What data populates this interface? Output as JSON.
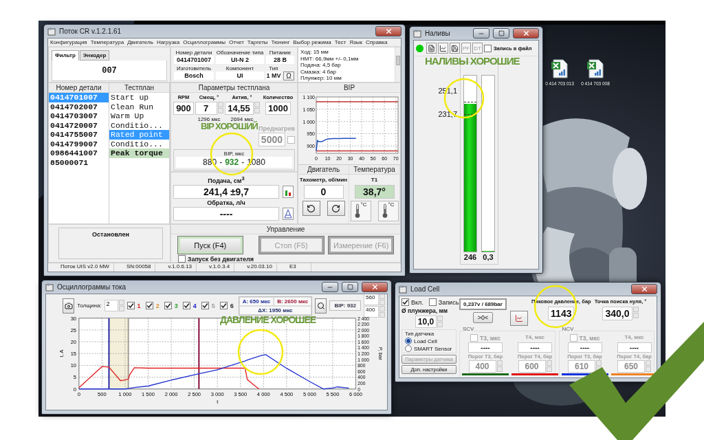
{
  "desktop": {
    "icons": [
      {
        "label": "0 414 703 013"
      },
      {
        "label": "0 414 703 008"
      }
    ]
  },
  "main_window": {
    "title": "Поток CR v.1.2.1.61",
    "menu": [
      "Конфигурация",
      "Температура",
      "Двигатель",
      "Нагрузка",
      "Осциллограммы",
      "Отчет",
      "Таргеты",
      "Тюнинг",
      "Выбор режима",
      "Тест",
      "Язык",
      "Справка"
    ],
    "filter": {
      "tabs": [
        {
          "label": "Фильтр",
          "selected": true
        },
        {
          "label": "Энкодер",
          "selected": false
        }
      ],
      "value": "007"
    },
    "part_info": {
      "fields": [
        {
          "label": "Номер детали",
          "value": "0414701007"
        },
        {
          "label": "Обозначение типа",
          "value": "UI-N 2"
        },
        {
          "label": "Питание",
          "value": "28 В"
        },
        {
          "label": "Изготовитель",
          "value": "Bosch"
        },
        {
          "label": "Компонент",
          "value": "UI"
        },
        {
          "label": "Тип",
          "value": "1 MV"
        }
      ],
      "button": "Ω"
    },
    "notes": [
      "Ход: 15 мм",
      "НМТ: 66,9мм +/- 0,1мм",
      "Подача: 4,5 бар",
      "Смазка: 4 бар",
      "Плунжер: 10 мм"
    ],
    "parts": {
      "header": "Номер детали",
      "items": [
        {
          "label": "0414701007",
          "selected": true
        },
        {
          "label": "0414702007",
          "selected": false
        },
        {
          "label": "0414703007",
          "selected": false
        },
        {
          "label": "0414720007",
          "selected": false
        },
        {
          "label": "0414755007",
          "selected": false
        },
        {
          "label": "0414799007",
          "selected": false
        },
        {
          "label": "0986441007",
          "selected": false
        },
        {
          "label": "85000071",
          "selected": false
        }
      ]
    },
    "testplan": {
      "header": "Тестплан",
      "items": [
        {
          "label": "Start up",
          "selected": false,
          "completed": false
        },
        {
          "label": "Clean Run",
          "selected": false,
          "completed": false
        },
        {
          "label": "Warm Up",
          "selected": false,
          "completed": false
        },
        {
          "label": "Conditio...",
          "selected": false,
          "completed": false
        },
        {
          "label": "Rated point",
          "selected": true,
          "completed": false
        },
        {
          "label": "Conditio...",
          "selected": false,
          "completed": false
        },
        {
          "label": "Peak torque",
          "selected": false,
          "completed": true
        }
      ]
    },
    "params": {
      "title": "Параметры тестплана",
      "fields": [
        {
          "label": "RPM",
          "value": "900",
          "kind": "plain"
        },
        {
          "label": "Смещ, °",
          "value": "7",
          "kind": "spin",
          "note": "1296 мкс"
        },
        {
          "label": "Актив, °",
          "value": "14,55",
          "kind": "spin",
          "note": "2694 мкс"
        },
        {
          "label": "Количество",
          "value": "1000",
          "kind": "plain"
        }
      ],
      "preheat": {
        "label": "Преднагрев",
        "value": "5000",
        "checked": false,
        "disabled": true
      },
      "bip": {
        "label": "BIP, мкс",
        "min": "880",
        "sep_1": "-",
        "value": "932",
        "sep_2": "-",
        "max": "1080"
      }
    },
    "feed": {
      "label": "Подача, см$^{3}$",
      "value": "241,4 ±9,7"
    },
    "return": {
      "label": "Обратка, л/ч",
      "value": "----"
    },
    "bip_chart": {
      "chart_data": {
        "type": "line",
        "title": "BIP",
        "x": [
          0,
          1,
          2,
          3,
          5,
          8,
          10,
          15,
          20,
          25,
          30,
          35,
          72
        ],
        "series": [
          {
            "color": "#c03030",
            "values": [
              1080,
              1080,
              1080,
              1080,
              1080,
              1080,
              1080,
              1080,
              1080,
              1080,
              1080,
              1080,
              1080
            ]
          },
          {
            "color": "#c03030",
            "values": [
              880,
              880,
              880,
              880,
              880,
              880,
              880,
              880,
              880,
              880,
              880,
              880,
              880
            ]
          },
          {
            "color": "#2050c0",
            "values": [
              880,
              922,
              918,
              918,
              918,
              925,
              928,
              930,
              930,
              931,
              931,
              931,
              null
            ]
          }
        ],
        "grid": true,
        "xlim": [
          0,
          72
        ],
        "ylim": [
          870,
          1100
        ],
        "xticks": [
          0,
          10,
          20,
          30,
          40,
          50,
          60,
          70
        ],
        "yticks": [
          {
            "value": 900,
            "label": "900"
          },
          {
            "value": 950,
            "label": "950"
          },
          {
            "value": 1000,
            "label": "1 000"
          },
          {
            "value": 1050,
            "label": "1 050"
          },
          {
            "value": 1100,
            "label": "1 100"
          }
        ]
      }
    },
    "engine": {
      "title": "Двигатель",
      "label": "Тахометр, об/мин",
      "value": "0"
    },
    "temperature": {
      "title": "Температура",
      "label": "T1",
      "value": "38,7°",
      "buttons": [
        "°C",
        "°C"
      ]
    },
    "status": "Остановлен",
    "control": {
      "title": "Управление",
      "buttons": [
        {
          "label": "Пуск (F4)",
          "disabled": false
        },
        {
          "label": "Стоп (F5)",
          "disabled": true
        },
        {
          "label": "Измерение (F6)",
          "disabled": true
        }
      ],
      "no_engine": {
        "label": "Запуск без двигателя",
        "checked": false
      }
    },
    "status_bar": [
      "Поток UIS v2.0 MW",
      "SN:00058",
      "v.1.0.6.13",
      "v.1.0.3.4",
      "v.20.03.10",
      "E3"
    ]
  },
  "levels_window": {
    "title": "Наливы",
    "connected": true,
    "text_buttons": [
      {
        "label": "PF",
        "disabled": true
      },
      {
        "label": "DT",
        "disabled": true
      }
    ],
    "record": {
      "label": "Запись в файл",
      "checked": false
    },
    "limits": [
      "251,1",
      "231,7"
    ],
    "bars": [
      {
        "level": 0.84,
        "value": "246"
      },
      {
        "level": 0,
        "value": "0,3"
      }
    ]
  },
  "scope_window": {
    "title": "Осциллограммы тока",
    "thickness_label": "Толщина:",
    "thickness": "2",
    "channels": [
      {
        "label": "1",
        "checked": true,
        "color": "#e02020"
      },
      {
        "label": "2",
        "checked": true,
        "color": "#e09030"
      },
      {
        "label": "3",
        "checked": true,
        "color": "#30a030"
      },
      {
        "label": "4",
        "checked": true,
        "color": "#2020d0"
      },
      {
        "label": "5",
        "checked": true,
        "color": "#a0a0a0"
      },
      {
        "label": "6",
        "checked": true,
        "color": "#303030"
      }
    ],
    "cursor_a": "A: 650 мкс",
    "cursor_b": "B: 2600 мкс",
    "delta": "ΔX: 1950 мкс",
    "bip": "BIP: 932",
    "range": [
      "560",
      "400"
    ],
    "chart_data": {
      "type": "line",
      "xlabel": "t",
      "ylabel": "I, A",
      "y2label": "P, bar",
      "x": [
        0,
        250,
        500,
        650,
        660,
        900,
        1000,
        1070,
        1100,
        1200,
        1500,
        2000,
        2500,
        3000,
        3500,
        3600,
        3650,
        3800,
        3900,
        4000,
        4050,
        4500,
        5000,
        5300,
        5500,
        5600,
        5800,
        5850
      ],
      "series": [
        {
          "color": "#e02020",
          "values": [
            0.5,
            5,
            9.5,
            9.3,
            9,
            3.5,
            3.8,
            4.2,
            6,
            9,
            8.8,
            8.8,
            8.8,
            8.8,
            8.8,
            8.8,
            4,
            1.5,
            0,
            null,
            null,
            null,
            null,
            null,
            null,
            null,
            null,
            null
          ]
        },
        {
          "color": "#2030d0",
          "axis": "y2",
          "values": [
            0,
            0,
            0,
            0,
            0,
            0,
            0,
            10,
            20,
            50,
            100,
            300,
            480,
            650,
            900,
            950,
            980,
            1060,
            1110,
            1150,
            1160,
            700,
            250,
            0,
            30,
            70,
            40,
            30
          ]
        }
      ],
      "grid": true,
      "xlim": [
        0,
        6000
      ],
      "ylim": [
        0,
        30
      ],
      "y2lim": [
        0,
        2400
      ],
      "xticks": [
        {
          "value": 0,
          "label": "0"
        },
        {
          "value": 500,
          "label": "500"
        },
        {
          "value": 1000,
          "label": "1 000"
        },
        {
          "value": 1500,
          "label": "1 500"
        },
        {
          "value": 2000,
          "label": "2 000"
        },
        {
          "value": 2500,
          "label": "2 500"
        },
        {
          "value": 3000,
          "label": "3 000"
        },
        {
          "value": 3500,
          "label": "3 500"
        },
        {
          "value": 4000,
          "label": "4 000"
        },
        {
          "value": 4500,
          "label": "4 500"
        },
        {
          "value": 5000,
          "label": "5 000"
        },
        {
          "value": 5500,
          "label": "5 500"
        },
        {
          "value": 6000,
          "label": "6 000"
        }
      ],
      "yticks": [
        0,
        5,
        10,
        15,
        20,
        25,
        30
      ],
      "y2ticks": [
        {
          "value": 0,
          "label": "0"
        },
        {
          "value": 200,
          "label": "200"
        },
        {
          "value": 400,
          "label": "400"
        },
        {
          "value": 600,
          "label": "600"
        },
        {
          "value": 800,
          "label": "800"
        },
        {
          "value": 1000,
          "label": "1 000"
        },
        {
          "value": 1200,
          "label": "1 200"
        },
        {
          "value": 1400,
          "label": "1 400"
        },
        {
          "value": 1600,
          "label": "1 600"
        },
        {
          "value": 1800,
          "label": "1 800"
        },
        {
          "value": 2000,
          "label": "2 000"
        },
        {
          "value": 2200,
          "label": "2 200"
        },
        {
          "value": 2400,
          "label": "2 400"
        }
      ],
      "bands": [
        {
          "axis": "x",
          "from": 650,
          "to": 1070,
          "color": "#f3efd8"
        }
      ],
      "ref_lines": [
        {
          "axis": "x",
          "value": 650,
          "color": "#1a1aa0"
        },
        {
          "axis": "x",
          "value": 2600,
          "color": "#800030"
        },
        {
          "axis": "x",
          "value": 1070,
          "color": "#a09a90"
        }
      ]
    }
  },
  "load_cell_window": {
    "title": "Load Cell",
    "enable": {
      "label": "Вкл.",
      "checked": true
    },
    "record": {
      "label": "Запись",
      "checked": false
    },
    "diameter_label": "Ø плунжера, мм",
    "diameter": "10,0",
    "sensor_group": "Тип датчика",
    "sensors": [
      {
        "label": "Load Cell",
        "selected": true
      },
      {
        "label": "SMART Sensor",
        "selected": false
      }
    ],
    "buttons": [
      {
        "label": "Параметры датчика",
        "disabled": true
      },
      {
        "label": "Доп. настройки",
        "disabled": false
      }
    ],
    "reading": "0,237v / 689bar",
    "zero_button": ">0<",
    "peak_label": "Пиковое давление, бар",
    "peak": "1143",
    "zero_label": "Точка поиска нуля, °",
    "zero": "340,0",
    "groups": [
      {
        "title": "SCV",
        "checked": false,
        "t3_label": "T3, мкс",
        "t3": "----",
        "t4_label": "T4, мкс",
        "t4": "----",
        "thresholds": [
          {
            "label": "Порог T3, бар",
            "value": "400",
            "color": "#1a6b1a"
          },
          {
            "label": "Порог T4, бар",
            "value": "600",
            "color": "#e01010"
          }
        ]
      },
      {
        "title": "NCV",
        "checked": false,
        "t3_label": "T3, мкс",
        "t3": "----",
        "t4_label": "T4, мкс",
        "t4": "----",
        "thresholds": [
          {
            "label": "Порог T3, бар",
            "value": "610",
            "color": "#1030e0"
          },
          {
            "label": "Порог T4, бар",
            "value": "650",
            "color": "#f08020"
          }
        ]
      }
    ]
  },
  "annotations": [
    {
      "text": "BIP ХОРОШИЙ"
    },
    {
      "text": "НАЛИВЫ ХОРОШИЕ"
    },
    {
      "text": "ДАВЛЕНИЕ ХОРОШЕЕ"
    }
  ]
}
